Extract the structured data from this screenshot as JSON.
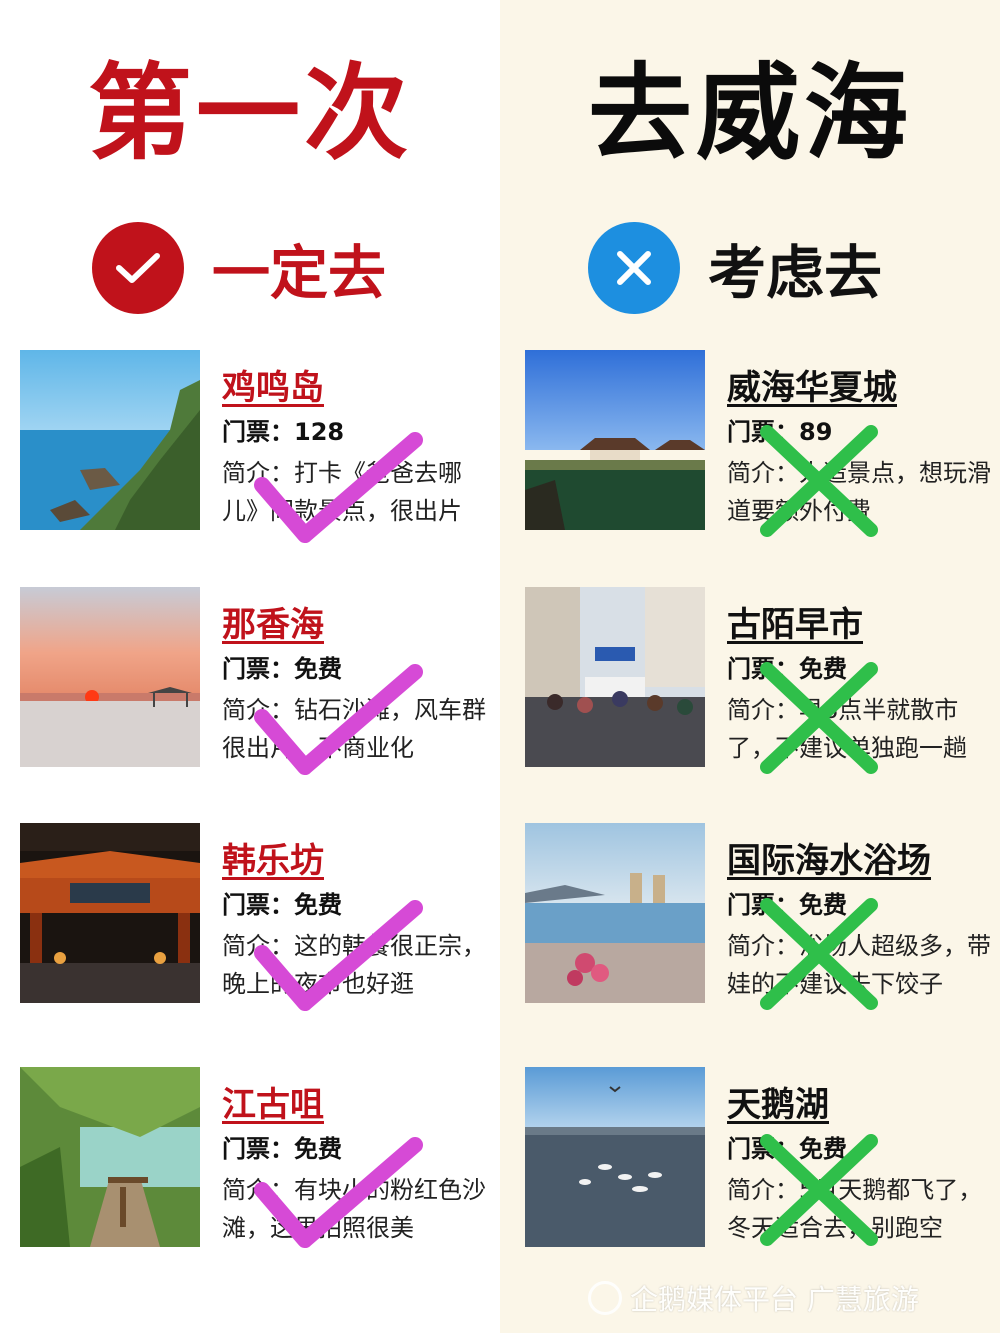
{
  "header": {
    "left_title": "第一次",
    "right_title": "去威海"
  },
  "tags": {
    "must_go": "一定去",
    "consider": "考虑去",
    "must_go_icon": "check-circle-icon",
    "consider_icon": "cross-circle-icon"
  },
  "colors": {
    "accent_red": "#c0121b",
    "accent_blue": "#1d8fe0",
    "check_purple": "#d64ad6",
    "cross_green": "#2fbf4a",
    "right_bg": "#fbf6e8"
  },
  "must_go": [
    {
      "name": "鸡鸣岛",
      "ticket": "门票：128",
      "desc": "简介：打卡《爸爸去哪儿》同款景点，很出片",
      "photo": "sea-cliff-photo"
    },
    {
      "name": "那香海",
      "ticket": "门票：免费",
      "desc": "简介：钻石沙滩，风车群很出片，不商业化",
      "photo": "sunset-beach-photo"
    },
    {
      "name": "韩乐坊",
      "ticket": "门票：免费",
      "desc": "简介：这的韩餐很正宗，晚上的夜市也好逛",
      "photo": "night-gate-photo"
    },
    {
      "name": "江古咀",
      "ticket": "门票：免费",
      "desc": "简介：有块小的粉红色沙滩，这里拍照很美",
      "photo": "green-path-photo"
    }
  ],
  "consider": [
    {
      "name": "威海华夏城",
      "ticket": "门票：89",
      "desc": "简介：人造景点，想玩滑道要额外付费",
      "photo": "palace-lake-photo"
    },
    {
      "name": "古陌早市",
      "ticket": "门票：免费",
      "desc": "简介：早8点半就散市了，不建议单独跑一趟",
      "photo": "street-market-photo"
    },
    {
      "name": "国际海水浴场",
      "ticket": "门票：免费",
      "desc": "简介：浴场人超级多，带娃的不建议去下饺子",
      "photo": "crowded-beach-photo"
    },
    {
      "name": "天鹅湖",
      "ticket": "门票：免费",
      "desc": "简介：5月天鹅都飞了，冬天适合去，别跑空",
      "photo": "swan-lake-photo"
    }
  ],
  "watermark": "企鹅媒体平台 广慧旅游"
}
